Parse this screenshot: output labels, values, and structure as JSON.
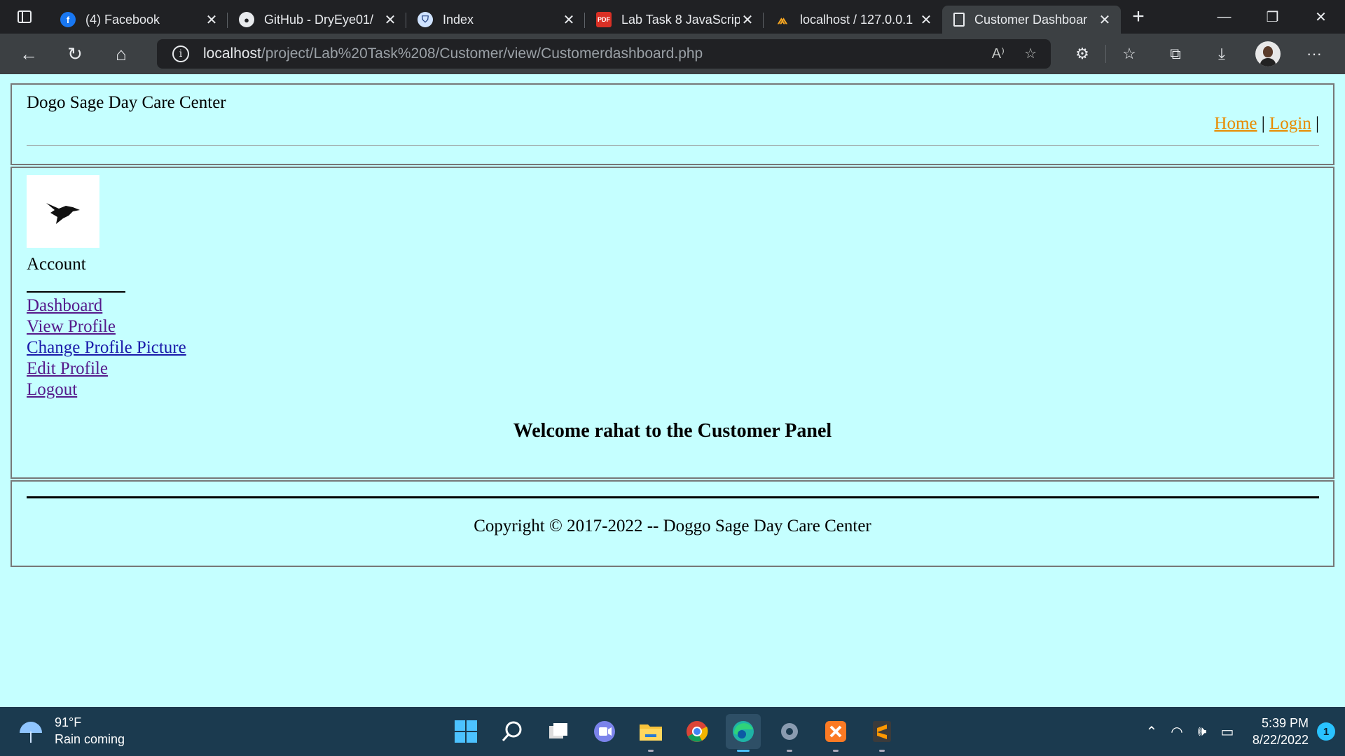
{
  "browser": {
    "tabs": [
      {
        "title": "(4) Facebook",
        "icon": "facebook-icon",
        "color": "#1877f2",
        "active": false
      },
      {
        "title": "GitHub - DryEye01/",
        "icon": "github-icon",
        "color": "#ffffff",
        "active": false
      },
      {
        "title": "Index",
        "icon": "shield-icon",
        "color": "#cfe3ff",
        "active": false
      },
      {
        "title": "Lab Task 8 JavaScrip",
        "icon": "pdf-icon",
        "color": "#d93025",
        "active": false
      },
      {
        "title": "localhost / 127.0.0.1",
        "icon": "phpmyadmin-icon",
        "color": "#f4a522",
        "active": false
      },
      {
        "title": "Customer Dashboar",
        "icon": "page-icon",
        "color": "#e8eaed",
        "active": true
      }
    ],
    "address": {
      "host": "localhost",
      "path": "/project/Lab%20Task%208/Customer/view/Customerdashboard.php"
    }
  },
  "page": {
    "site_title": "Dogo Sage Day Care Center",
    "nav": {
      "home": "Home",
      "sep1": "|",
      "login": "Login",
      "sep2": "|"
    },
    "account_label": "Account",
    "menu": [
      "Dashboard",
      "View Profile",
      "Change Profile Picture",
      "Edit Profile",
      "Logout"
    ],
    "welcome": "Welcome rahat to the Customer Panel",
    "copyright": "Copyright © 2017-2022 -- Doggo Sage Day Care Center"
  },
  "taskbar": {
    "weather": {
      "temp": "91°F",
      "desc": "Rain coming"
    },
    "time": "5:39 PM",
    "date": "8/22/2022",
    "notification_count": "1"
  },
  "colors": {
    "page_bg": "#c5ffff",
    "nav_link": "#e88b00",
    "menu_link": "#1a1aaa",
    "visited_link": "#551a8b"
  }
}
